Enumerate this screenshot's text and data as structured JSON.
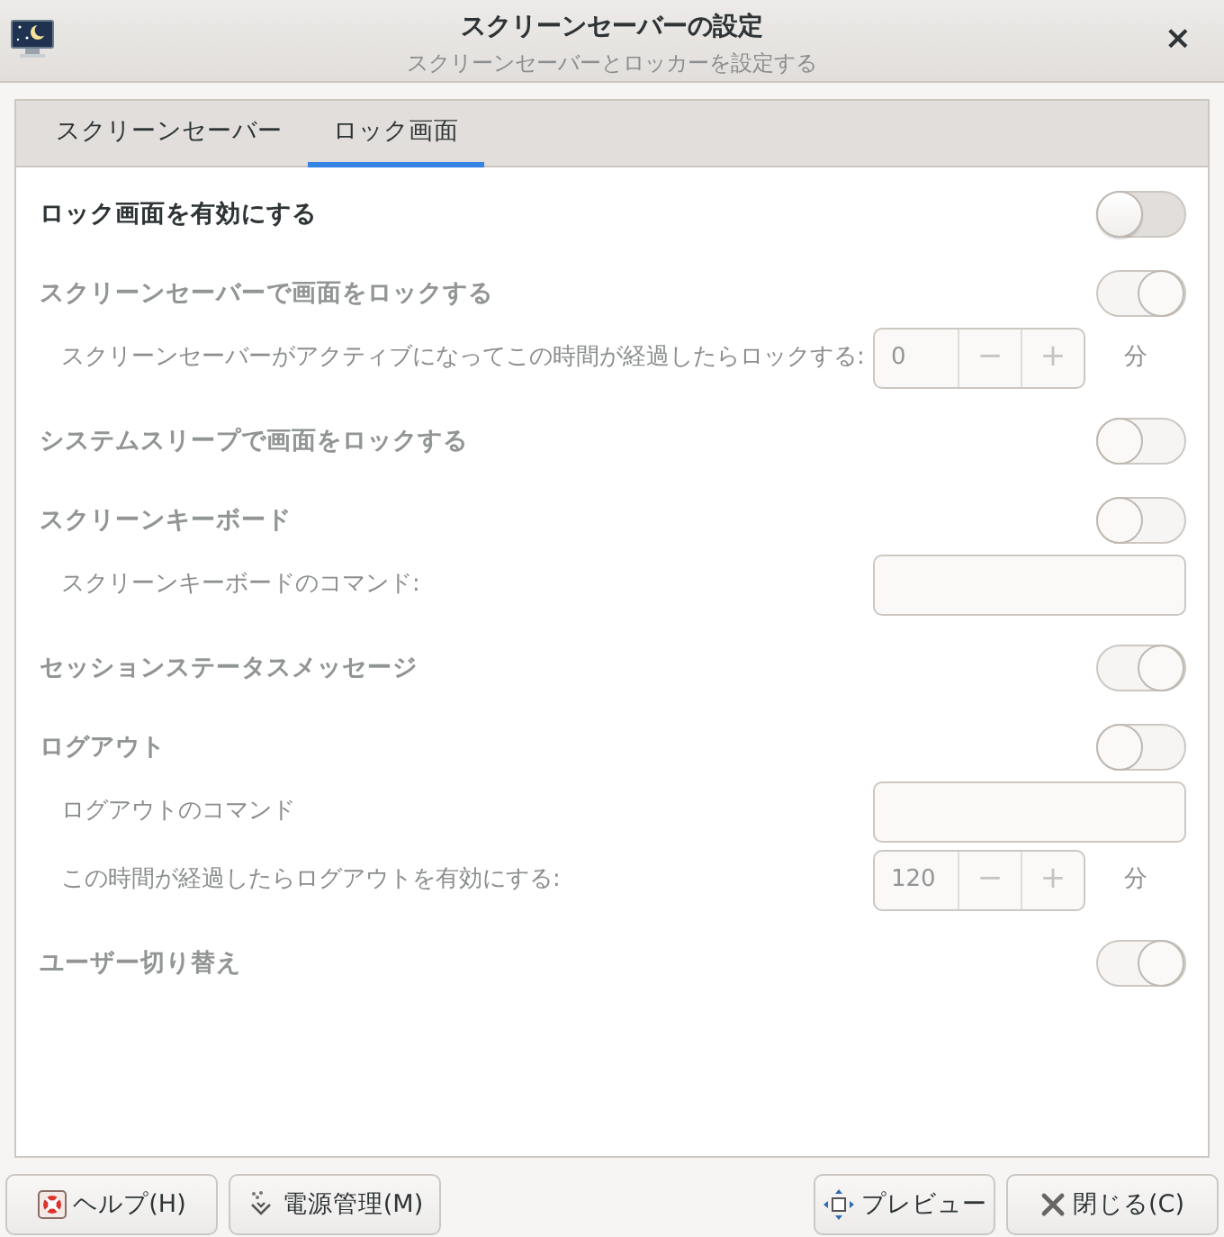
{
  "window": {
    "title": "スクリーンセーバーの設定",
    "subtitle": "スクリーンセーバーとロッカーを設定する",
    "close": "×"
  },
  "tabs": [
    {
      "label": "スクリーンセーバー",
      "selected": false
    },
    {
      "label": "ロック画面",
      "selected": true
    }
  ],
  "rows": [
    {
      "kind": "switch",
      "label": "ロック画面を有効にする",
      "on": false,
      "disabled": false
    },
    {
      "kind": "switch",
      "label": "スクリーンセーバーで画面をロックする",
      "on": true,
      "disabled": true
    },
    {
      "kind": "spin",
      "label": "スクリーンセーバーがアクティブになってこの時間が経過したらロックする:",
      "value": "0",
      "minus": "−",
      "plus": "+",
      "unit": "分",
      "disabled": true
    },
    {
      "kind": "switch",
      "label": "システムスリープで画面をロックする",
      "on": false,
      "disabled": true
    },
    {
      "kind": "switch",
      "label": "スクリーンキーボード",
      "on": false,
      "disabled": true
    },
    {
      "kind": "entry",
      "label": "スクリーンキーボードのコマンド:",
      "disabled": true
    },
    {
      "kind": "switch",
      "label": "セッションステータスメッセージ",
      "on": true,
      "disabled": true
    },
    {
      "kind": "switch",
      "label": "ログアウト",
      "on": false,
      "disabled": true
    },
    {
      "kind": "entry",
      "label": "ログアウトのコマンド",
      "disabled": true
    },
    {
      "kind": "spin",
      "label": "この時間が経過したらログアウトを有効にする:",
      "value": "120",
      "minus": "−",
      "plus": "+",
      "unit": "分",
      "disabled": true
    },
    {
      "kind": "switch",
      "label": "ユーザー切り替え",
      "on": true,
      "disabled": true
    }
  ],
  "buttons": [
    {
      "kind": "help",
      "label": "ヘルプ(H)"
    },
    {
      "kind": "power",
      "label": "電源管理(M)"
    },
    {
      "kind": "preview",
      "label": "プレビュー"
    },
    {
      "kind": "close",
      "label": "閉じる(C)"
    }
  ]
}
